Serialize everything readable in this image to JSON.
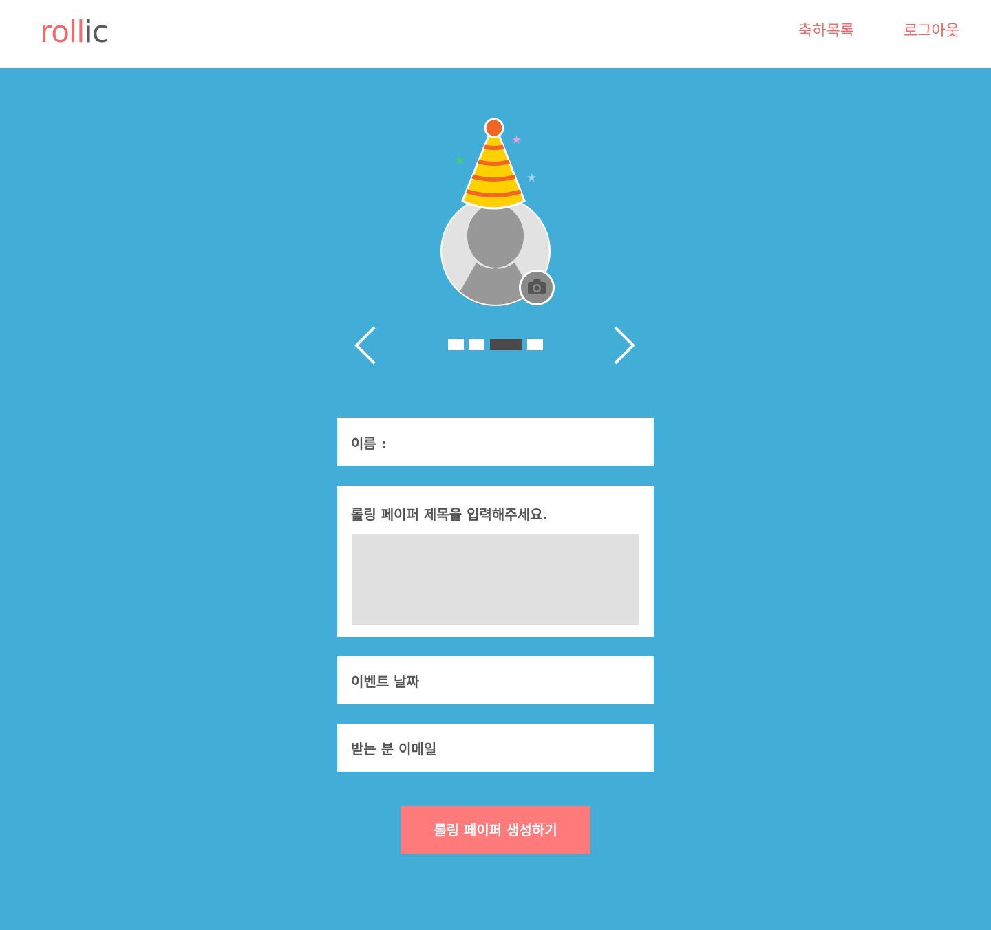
{
  "header": {
    "logo_part1": "roll",
    "logo_part2": "ic",
    "nav_list": "축하목록",
    "nav_logout": "로그아웃"
  },
  "colors": {
    "brand": "#f26b6b",
    "background": "#42aed8",
    "button": "#ff7b7b",
    "field_fill": "#e0e0e0"
  },
  "carousel": {
    "slides": 4,
    "active_index": 2
  },
  "form": {
    "name_label": "이름 :",
    "title_label": "롤링 페이퍼 제목을 입력해주세요.",
    "date_label": "이벤트 날짜",
    "email_label": "받는 분 이메일",
    "submit_label": "롤링 페이퍼 생성하기"
  }
}
